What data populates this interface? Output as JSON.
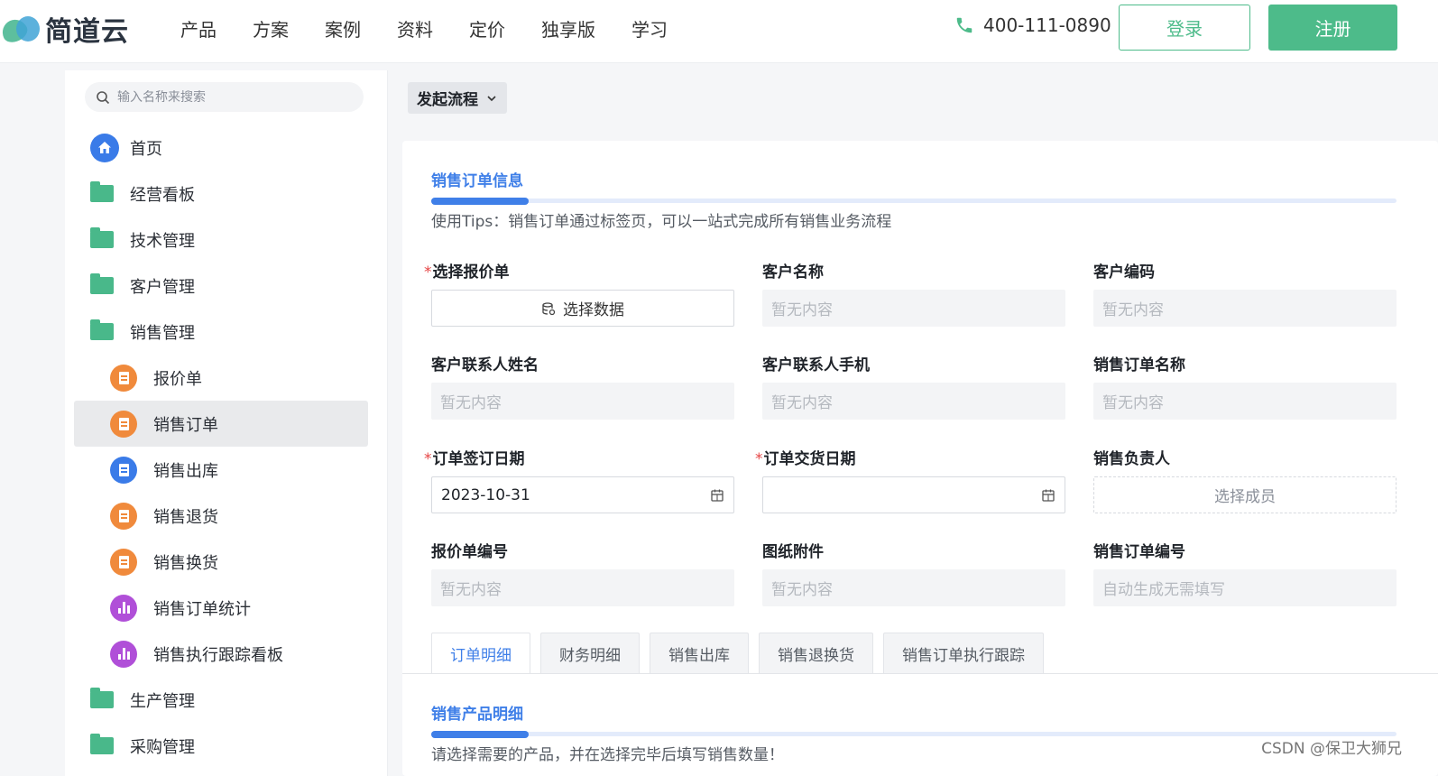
{
  "header": {
    "logo_text": "简道云",
    "nav": [
      "产品",
      "方案",
      "案例",
      "资料",
      "定价",
      "独享版",
      "学习"
    ],
    "phone": "400-111-0890",
    "login_label": "登录",
    "register_label": "注册"
  },
  "sidebar": {
    "search_placeholder": "输入名称来搜索",
    "items": [
      {
        "label": "首页",
        "icon": "home-icon",
        "level": 1
      },
      {
        "label": "经营看板",
        "icon": "folder-icon",
        "level": 1
      },
      {
        "label": "技术管理",
        "icon": "folder-icon",
        "level": 1
      },
      {
        "label": "客户管理",
        "icon": "folder-icon",
        "level": 1
      },
      {
        "label": "销售管理",
        "icon": "folder-open-icon",
        "level": 1
      },
      {
        "label": "报价单",
        "icon": "form-icon",
        "level": 2,
        "color": "#f08a3c"
      },
      {
        "label": "销售订单",
        "icon": "form-icon",
        "level": 2,
        "color": "#f08a3c",
        "active": true
      },
      {
        "label": "销售出库",
        "icon": "form-icon",
        "level": 2,
        "color": "#3a7be8"
      },
      {
        "label": "销售退货",
        "icon": "form-icon",
        "level": 2,
        "color": "#f08a3c"
      },
      {
        "label": "销售换货",
        "icon": "form-icon",
        "level": 2,
        "color": "#f08a3c"
      },
      {
        "label": "销售订单统计",
        "icon": "chart-icon",
        "level": 2,
        "color": "#b04fd8"
      },
      {
        "label": "销售执行跟踪看板",
        "icon": "chart-icon",
        "level": 2,
        "color": "#b04fd8"
      },
      {
        "label": "生产管理",
        "icon": "folder-icon",
        "level": 1
      },
      {
        "label": "采购管理",
        "icon": "folder-icon",
        "level": 1
      }
    ]
  },
  "main": {
    "launch_label": "发起流程",
    "section1": {
      "title": "销售订单信息",
      "tips": "使用Tips：销售订单通过标签页，可以一站式完成所有销售业务流程"
    },
    "fields": {
      "quote_select": {
        "label": "选择报价单",
        "required": true,
        "button": "选择数据"
      },
      "customer_name": {
        "label": "客户名称",
        "placeholder": "暂无内容"
      },
      "customer_code": {
        "label": "客户编码",
        "placeholder": "暂无内容"
      },
      "contact_name": {
        "label": "客户联系人姓名",
        "placeholder": "暂无内容"
      },
      "contact_phone": {
        "label": "客户联系人手机",
        "placeholder": "暂无内容"
      },
      "order_name": {
        "label": "销售订单名称",
        "placeholder": "暂无内容"
      },
      "sign_date": {
        "label": "订单签订日期",
        "required": true,
        "value": "2023-10-31"
      },
      "delivery_date": {
        "label": "订单交货日期",
        "required": true,
        "value": ""
      },
      "sales_owner": {
        "label": "销售负责人",
        "button": "选择成员"
      },
      "quote_no": {
        "label": "报价单编号",
        "placeholder": "暂无内容"
      },
      "attachment": {
        "label": "图纸附件",
        "placeholder": "暂无内容"
      },
      "order_no": {
        "label": "销售订单编号",
        "placeholder": "自动生成无需填写"
      }
    },
    "tabs": [
      "订单明细",
      "财务明细",
      "销售出库",
      "销售退换货",
      "销售订单执行跟踪"
    ],
    "section2": {
      "title": "销售产品明细",
      "tips": "请选择需要的产品，并在选择完毕后填写销售数量！"
    }
  },
  "watermark": "CSDN @保卫大狮兄",
  "colors": {
    "brand_green": "#4dbb8a",
    "accent_blue": "#3f7fe8",
    "required_red": "#e64545"
  }
}
